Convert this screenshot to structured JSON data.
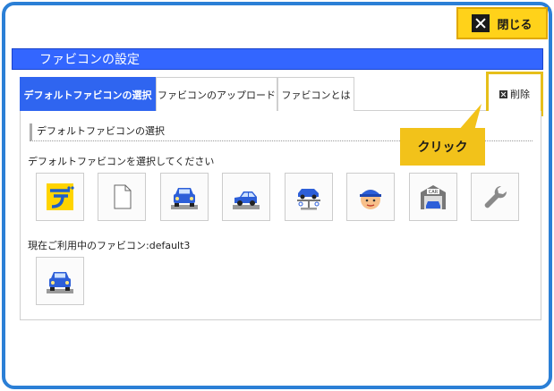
{
  "close_button": {
    "label": "閉じる"
  },
  "panel": {
    "title": "ファビコンの設定"
  },
  "tabs": [
    {
      "label": "デフォルトファビコンの選択",
      "active": true
    },
    {
      "label": "ファビコンのアップロード",
      "active": false
    },
    {
      "label": "ファビコンとは",
      "active": false
    }
  ],
  "delete_button": {
    "label": "削除"
  },
  "section": {
    "heading": "デフォルトファビコンの選択"
  },
  "callout": {
    "text": "クリック"
  },
  "select_prompt": "デフォルトファビコンを選択してください",
  "icons": [
    {
      "name": "yellow-de-logo-icon"
    },
    {
      "name": "blank-document-icon"
    },
    {
      "name": "blue-car-front-icon"
    },
    {
      "name": "blue-car-side-icon"
    },
    {
      "name": "car-lift-icon"
    },
    {
      "name": "mechanic-face-icon"
    },
    {
      "name": "car-garage-icon"
    },
    {
      "name": "wrench-icon"
    }
  ],
  "current": {
    "label": "現在ご利用中のファビコン:default3",
    "icon": "blue-car-front-icon"
  },
  "colors": {
    "frame": "#2b7fd6",
    "title_bar": "#3366ff",
    "active_tab": "#2f65f0",
    "highlight": "#e6bf1a",
    "close_button": "#ffd21a",
    "callout": "#f2c21a"
  }
}
